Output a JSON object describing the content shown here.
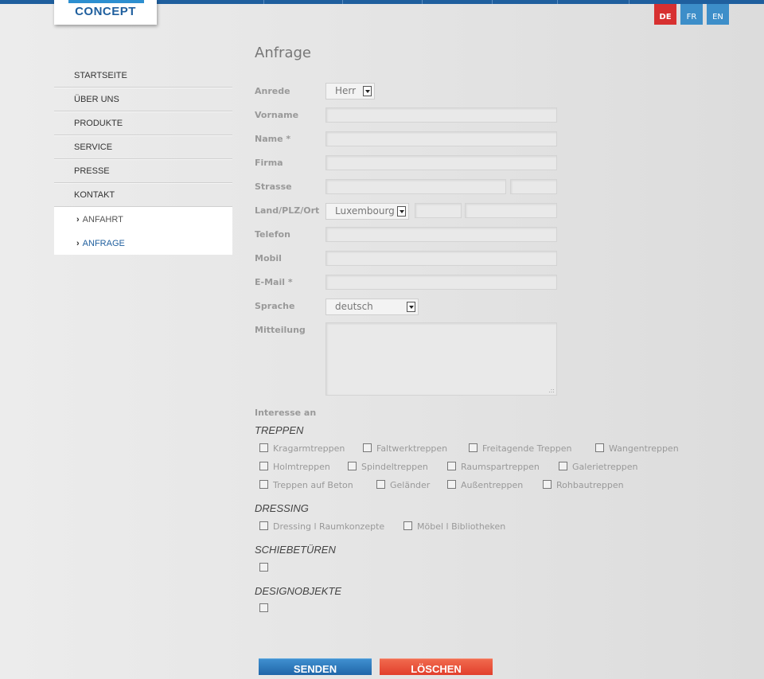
{
  "brand": {
    "logo_text": "CONCEPT"
  },
  "languages": [
    "DE",
    "FR",
    "EN"
  ],
  "nav": {
    "items": [
      "STARTSEITE",
      "ÜBER UNS",
      "PRODUKTE",
      "SERVICE",
      "PRESSE",
      "KONTAKT"
    ],
    "subitems": [
      "ANFAHRT",
      "ANFRAGE"
    ],
    "chevron": "›"
  },
  "form": {
    "title": "Anfrage",
    "labels": {
      "anrede": "Anrede",
      "vorname": "Vorname",
      "name": "Name *",
      "firma": "Firma",
      "strasse": "Strasse",
      "land": "Land/PLZ/Ort",
      "telefon": "Telefon",
      "mobil": "Mobil",
      "email": "E-Mail *",
      "sprache": "Sprache",
      "mitteilung": "Mitteilung"
    },
    "anrede_value": "Herr",
    "land_value": "Luxembourg",
    "sprache_value": "deutsch",
    "grip": ".::"
  },
  "interests": {
    "heading": "Interesse an",
    "treppen": {
      "title": "TREPPEN",
      "items": [
        "Kragarmtreppen",
        "Faltwerktreppen",
        "Freitagende Treppen",
        "Wangentreppen",
        "Holmtreppen",
        "Spindeltreppen",
        "Raumspartreppen",
        "Galerietreppen",
        "Treppen auf Beton",
        "Geländer",
        "Außentreppen",
        "Rohbautreppen"
      ]
    },
    "dressing": {
      "title": "DRESSING",
      "items": [
        "Dressing l Raumkonzepte",
        "Möbel l Bibliotheken"
      ]
    },
    "schiebeturen": {
      "title": "SCHIEBETÜREN"
    },
    "designobjekte": {
      "title": "DESIGNOBJEKTE"
    }
  },
  "buttons": {
    "send": "SENDEN",
    "clear": "LÖSCHEN"
  },
  "colors": {
    "accent_blue": "#1f5f9e",
    "red": "#d73030",
    "button_blue": "#2f7fc0",
    "button_red": "#e94f38"
  }
}
